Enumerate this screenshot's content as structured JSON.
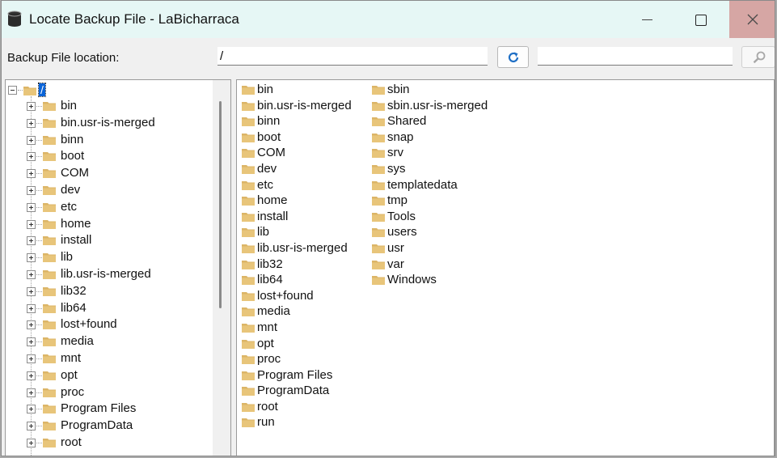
{
  "window": {
    "title": "Locate Backup File - LaBicharraca",
    "icons": {
      "app": "database-icon",
      "minimize": "minimize-icon",
      "maximize": "maximize-icon",
      "close": "close-icon"
    }
  },
  "location_bar": {
    "label": "Backup File location:",
    "path_value": "/",
    "refresh_icon": "refresh-icon",
    "search_value": "",
    "search_icon": "search-icon"
  },
  "tree": {
    "root_label": "/",
    "items": [
      {
        "label": "bin"
      },
      {
        "label": "bin.usr-is-merged"
      },
      {
        "label": "binn"
      },
      {
        "label": "boot"
      },
      {
        "label": "COM"
      },
      {
        "label": "dev"
      },
      {
        "label": "etc"
      },
      {
        "label": "home"
      },
      {
        "label": "install"
      },
      {
        "label": "lib"
      },
      {
        "label": "lib.usr-is-merged"
      },
      {
        "label": "lib32"
      },
      {
        "label": "lib64"
      },
      {
        "label": "lost+found"
      },
      {
        "label": "media"
      },
      {
        "label": "mnt"
      },
      {
        "label": "opt"
      },
      {
        "label": "proc"
      },
      {
        "label": "Program Files"
      },
      {
        "label": "ProgramData"
      },
      {
        "label": "root"
      }
    ]
  },
  "files": {
    "column1": [
      {
        "label": "bin"
      },
      {
        "label": "bin.usr-is-merged"
      },
      {
        "label": "binn"
      },
      {
        "label": "boot"
      },
      {
        "label": "COM"
      },
      {
        "label": "dev"
      },
      {
        "label": "etc"
      },
      {
        "label": "home"
      },
      {
        "label": "install"
      },
      {
        "label": "lib"
      },
      {
        "label": "lib.usr-is-merged"
      },
      {
        "label": "lib32"
      },
      {
        "label": "lib64"
      },
      {
        "label": "lost+found"
      },
      {
        "label": "media"
      },
      {
        "label": "mnt"
      },
      {
        "label": "opt"
      },
      {
        "label": "proc"
      },
      {
        "label": "Program Files"
      },
      {
        "label": "ProgramData"
      },
      {
        "label": "root"
      },
      {
        "label": "run"
      }
    ],
    "column2": [
      {
        "label": "sbin"
      },
      {
        "label": "sbin.usr-is-merged"
      },
      {
        "label": "Shared"
      },
      {
        "label": "snap"
      },
      {
        "label": "srv"
      },
      {
        "label": "sys"
      },
      {
        "label": "templatedata"
      },
      {
        "label": "tmp"
      },
      {
        "label": "Tools"
      },
      {
        "label": "users"
      },
      {
        "label": "usr"
      },
      {
        "label": "var"
      },
      {
        "label": "Windows"
      }
    ]
  },
  "colors": {
    "titlebar": "#e6f7f5",
    "close_button": "#d6a6a4",
    "selection": "#0a64d8",
    "folder": "#dcb567",
    "refresh_icon": "#1f6fc5"
  }
}
